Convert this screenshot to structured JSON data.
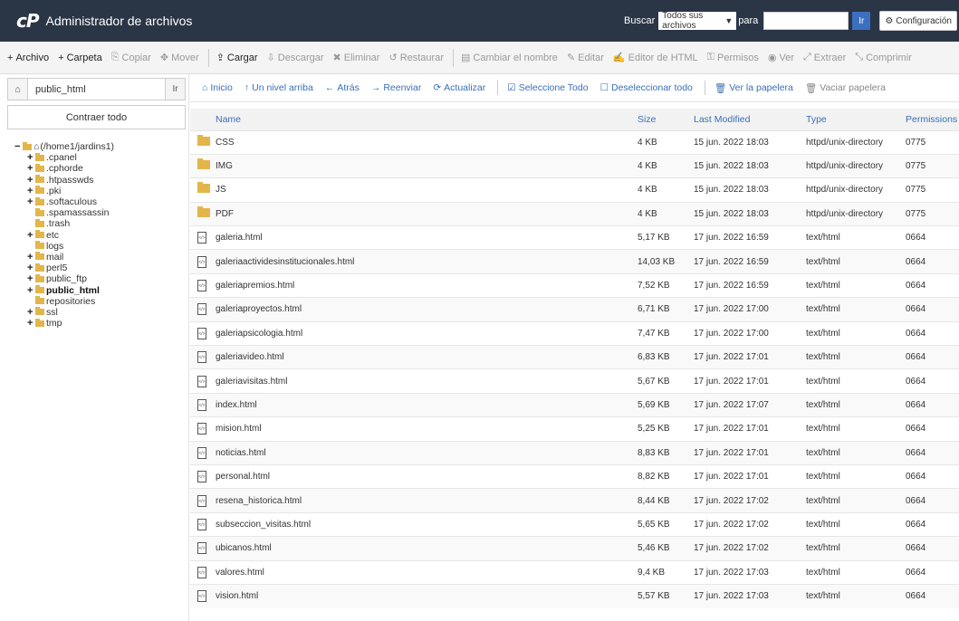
{
  "header": {
    "logo": "cP",
    "title": "Administrador de archivos",
    "search_label": "Buscar",
    "search_scope": "Todos sus archivos",
    "for_label": "para",
    "search_value": "",
    "go": "Ir",
    "settings": "Configuración"
  },
  "toolbar": [
    {
      "icon": "+",
      "label": "Archivo",
      "enabled": true,
      "name": "new-file-button"
    },
    {
      "icon": "+",
      "label": "Carpeta",
      "enabled": true,
      "name": "new-folder-button"
    },
    {
      "icon": "⎘",
      "label": "Copiar",
      "enabled": false,
      "name": "copy-button"
    },
    {
      "icon": "✥",
      "label": "Mover",
      "enabled": false,
      "name": "move-button"
    },
    {
      "icon": "⇪",
      "label": "Cargar",
      "enabled": true,
      "name": "upload-button"
    },
    {
      "icon": "⇩",
      "label": "Descargar",
      "enabled": false,
      "name": "download-button"
    },
    {
      "icon": "✖",
      "label": "Eliminar",
      "enabled": false,
      "name": "delete-button"
    },
    {
      "icon": "↺",
      "label": "Restaurar",
      "enabled": false,
      "name": "restore-button"
    },
    {
      "icon": "▤",
      "label": "Cambiar el nombre",
      "enabled": false,
      "name": "rename-button"
    },
    {
      "icon": "✎",
      "label": "Editar",
      "enabled": false,
      "name": "edit-button"
    },
    {
      "icon": "✍",
      "label": "Editor de HTML",
      "enabled": false,
      "name": "html-editor-button"
    },
    {
      "icon": "⚿",
      "label": "Permisos",
      "enabled": false,
      "name": "permissions-button"
    },
    {
      "icon": "◉",
      "label": "Ver",
      "enabled": false,
      "name": "view-button"
    },
    {
      "icon": "⤢",
      "label": "Extraer",
      "enabled": false,
      "name": "extract-button"
    },
    {
      "icon": "⤡",
      "label": "Comprimir",
      "enabled": false,
      "name": "compress-button"
    }
  ],
  "sidebar": {
    "path_value": "public_html",
    "go": "Ir",
    "collapse": "Contraer todo",
    "tree": [
      {
        "pm": "−",
        "label": "(/home1/jardins1)",
        "home": true,
        "indent": 0,
        "bold": false
      },
      {
        "pm": "+",
        "label": ".cpanel",
        "indent": 1,
        "bold": false
      },
      {
        "pm": "+",
        "label": ".cphorde",
        "indent": 1,
        "bold": false
      },
      {
        "pm": "+",
        "label": ".htpasswds",
        "indent": 1,
        "bold": false
      },
      {
        "pm": "+",
        "label": ".pki",
        "indent": 1,
        "bold": false
      },
      {
        "pm": "+",
        "label": ".softaculous",
        "indent": 1,
        "bold": false
      },
      {
        "pm": "",
        "label": ".spamassassin",
        "indent": 1,
        "bold": false
      },
      {
        "pm": "",
        "label": ".trash",
        "indent": 1,
        "bold": false
      },
      {
        "pm": "+",
        "label": "etc",
        "indent": 1,
        "bold": false
      },
      {
        "pm": "",
        "label": "logs",
        "indent": 1,
        "bold": false
      },
      {
        "pm": "+",
        "label": "mail",
        "indent": 1,
        "bold": false
      },
      {
        "pm": "+",
        "label": "perl5",
        "indent": 1,
        "bold": false
      },
      {
        "pm": "+",
        "label": "public_ftp",
        "indent": 1,
        "bold": false
      },
      {
        "pm": "+",
        "label": "public_html",
        "indent": 1,
        "bold": true
      },
      {
        "pm": "",
        "label": "repositories",
        "indent": 1,
        "bold": false
      },
      {
        "pm": "+",
        "label": "ssl",
        "indent": 1,
        "bold": false
      },
      {
        "pm": "+",
        "label": "tmp",
        "indent": 1,
        "bold": false
      }
    ]
  },
  "nav": [
    {
      "icon": "⌂",
      "label": "Inicio",
      "name": "home-link",
      "gray": false
    },
    {
      "icon": "↑",
      "label": "Un nivel arriba",
      "name": "up-one-level-link",
      "gray": false
    },
    {
      "icon": "←",
      "label": "Atrás",
      "name": "back-link",
      "gray": false
    },
    {
      "icon": "→",
      "label": "Reenviar",
      "name": "forward-link",
      "gray": false
    },
    {
      "icon": "⟳",
      "label": "Actualizar",
      "name": "reload-link",
      "gray": false
    },
    {
      "icon": "☑",
      "label": "Seleccione Todo",
      "name": "select-all-link",
      "gray": false
    },
    {
      "icon": "☐",
      "label": "Deseleccionar todo",
      "name": "unselect-all-link",
      "gray": false
    },
    {
      "icon": "🗑",
      "label": "Ver la papelera",
      "name": "view-trash-link",
      "gray": false
    },
    {
      "icon": "🗑",
      "label": "Vaciar papelera",
      "name": "empty-trash-link",
      "gray": true
    }
  ],
  "columns": [
    "Name",
    "Size",
    "Last Modified",
    "Type",
    "Permissions"
  ],
  "files": [
    {
      "kind": "dir",
      "name": "CSS",
      "size": "4 KB",
      "modified": "15 jun. 2022 18:03",
      "type": "httpd/unix-directory",
      "perms": "0775"
    },
    {
      "kind": "dir",
      "name": "IMG",
      "size": "4 KB",
      "modified": "15 jun. 2022 18:03",
      "type": "httpd/unix-directory",
      "perms": "0775"
    },
    {
      "kind": "dir",
      "name": "JS",
      "size": "4 KB",
      "modified": "15 jun. 2022 18:03",
      "type": "httpd/unix-directory",
      "perms": "0775"
    },
    {
      "kind": "dir",
      "name": "PDF",
      "size": "4 KB",
      "modified": "15 jun. 2022 18:03",
      "type": "httpd/unix-directory",
      "perms": "0775"
    },
    {
      "kind": "file",
      "name": "galeria.html",
      "size": "5,17 KB",
      "modified": "17 jun. 2022 16:59",
      "type": "text/html",
      "perms": "0664"
    },
    {
      "kind": "file",
      "name": "galeriaactividesinstitucionales.html",
      "size": "14,03 KB",
      "modified": "17 jun. 2022 16:59",
      "type": "text/html",
      "perms": "0664"
    },
    {
      "kind": "file",
      "name": "galeriapremios.html",
      "size": "7,52 KB",
      "modified": "17 jun. 2022 16:59",
      "type": "text/html",
      "perms": "0664"
    },
    {
      "kind": "file",
      "name": "galeriaproyectos.html",
      "size": "6,71 KB",
      "modified": "17 jun. 2022 17:00",
      "type": "text/html",
      "perms": "0664"
    },
    {
      "kind": "file",
      "name": "galeriapsicologia.html",
      "size": "7,47 KB",
      "modified": "17 jun. 2022 17:00",
      "type": "text/html",
      "perms": "0664"
    },
    {
      "kind": "file",
      "name": "galeriavideo.html",
      "size": "6,83 KB",
      "modified": "17 jun. 2022 17:01",
      "type": "text/html",
      "perms": "0664"
    },
    {
      "kind": "file",
      "name": "galeriavisitas.html",
      "size": "5,67 KB",
      "modified": "17 jun. 2022 17:01",
      "type": "text/html",
      "perms": "0664"
    },
    {
      "kind": "file",
      "name": "index.html",
      "size": "5,69 KB",
      "modified": "17 jun. 2022 17:07",
      "type": "text/html",
      "perms": "0664"
    },
    {
      "kind": "file",
      "name": "mision.html",
      "size": "5,25 KB",
      "modified": "17 jun. 2022 17:01",
      "type": "text/html",
      "perms": "0664"
    },
    {
      "kind": "file",
      "name": "noticias.html",
      "size": "8,83 KB",
      "modified": "17 jun. 2022 17:01",
      "type": "text/html",
      "perms": "0664"
    },
    {
      "kind": "file",
      "name": "personal.html",
      "size": "8,82 KB",
      "modified": "17 jun. 2022 17:01",
      "type": "text/html",
      "perms": "0664"
    },
    {
      "kind": "file",
      "name": "resena_historica.html",
      "size": "8,44 KB",
      "modified": "17 jun. 2022 17:02",
      "type": "text/html",
      "perms": "0664"
    },
    {
      "kind": "file",
      "name": "subseccion_visitas.html",
      "size": "5,65 KB",
      "modified": "17 jun. 2022 17:02",
      "type": "text/html",
      "perms": "0664"
    },
    {
      "kind": "file",
      "name": "ubicanos.html",
      "size": "5,46 KB",
      "modified": "17 jun. 2022 17:02",
      "type": "text/html",
      "perms": "0664"
    },
    {
      "kind": "file",
      "name": "valores.html",
      "size": "9,4 KB",
      "modified": "17 jun. 2022 17:03",
      "type": "text/html",
      "perms": "0664"
    },
    {
      "kind": "file",
      "name": "vision.html",
      "size": "5,57 KB",
      "modified": "17 jun. 2022 17:03",
      "type": "text/html",
      "perms": "0664"
    }
  ],
  "colors": {
    "header_bg": "#2a3546",
    "link": "#3a6fb8",
    "folder": "#e2b64a"
  }
}
